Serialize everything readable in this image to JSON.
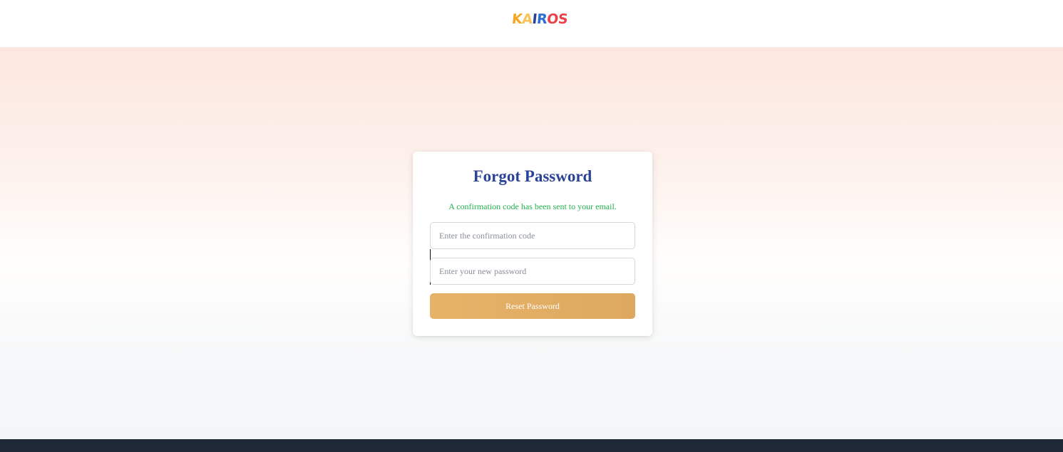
{
  "header": {
    "logo": {
      "letters": [
        {
          "char": "K",
          "color": "#f5a623"
        },
        {
          "char": "A",
          "color": "#f7c35a"
        },
        {
          "char": "I",
          "color": "#2b4396"
        },
        {
          "char": "R",
          "color": "#2b6fd6"
        },
        {
          "char": "O",
          "color": "#e8434b"
        },
        {
          "char": "S",
          "color": "#e8434b"
        }
      ],
      "text": "KAIROS"
    }
  },
  "card": {
    "title": "Forgot Password",
    "message": "A confirmation code has been sent to your email.",
    "code_field": {
      "placeholder": "Enter the confirmation code",
      "value": ""
    },
    "password_field": {
      "placeholder": "Enter your new password",
      "value": ""
    },
    "reset_label": "Reset Password"
  },
  "colors": {
    "title": "#2b4396",
    "success": "#22b14c",
    "button": "#e2af66",
    "footer": "#1f2836"
  }
}
